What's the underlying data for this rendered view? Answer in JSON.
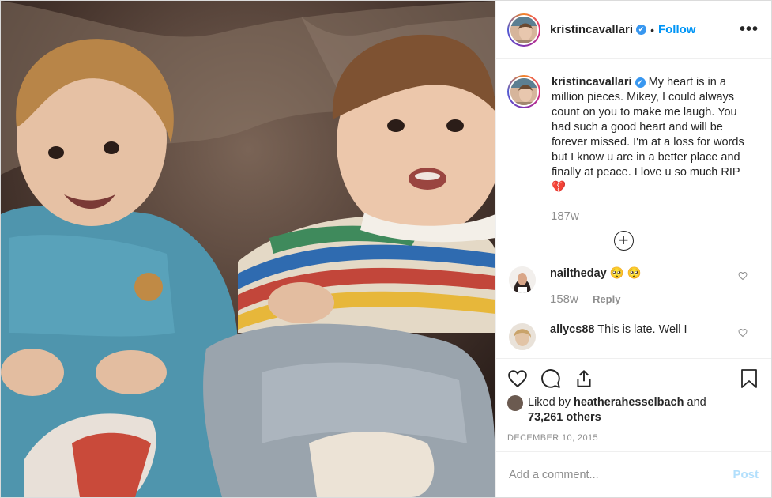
{
  "header": {
    "username": "kristincavallari",
    "verified_mark": "✔",
    "separator": "•",
    "follow_label": "Follow",
    "more_label": "•••"
  },
  "caption": {
    "username": "kristincavallari",
    "text": "My heart is in a million pieces. Mikey, I could always count on you to make me laugh. You had such a good heart and will be forever missed. I'm at a loss for words but I know u are in a better place and finally at peace. I love u so much RIP 💔",
    "time": "187w"
  },
  "load_more_label": "+",
  "comments": [
    {
      "username": "nailtheday",
      "text": "🥺 🥺",
      "time": "158w",
      "reply_label": "Reply"
    },
    {
      "username": "allycs88",
      "text": "This is late. Well I"
    }
  ],
  "likes": {
    "prefix": "Liked by",
    "user": "heatherahesselbach",
    "conjunction": "and",
    "count": "73,261 others"
  },
  "date": "DECEMBER 10, 2015",
  "add_comment": {
    "placeholder": "Add a comment...",
    "post_label": "Post"
  },
  "colors": {
    "accent": "#0095f6",
    "verified": "#3897f0",
    "post_disabled": "#b2dffc"
  }
}
